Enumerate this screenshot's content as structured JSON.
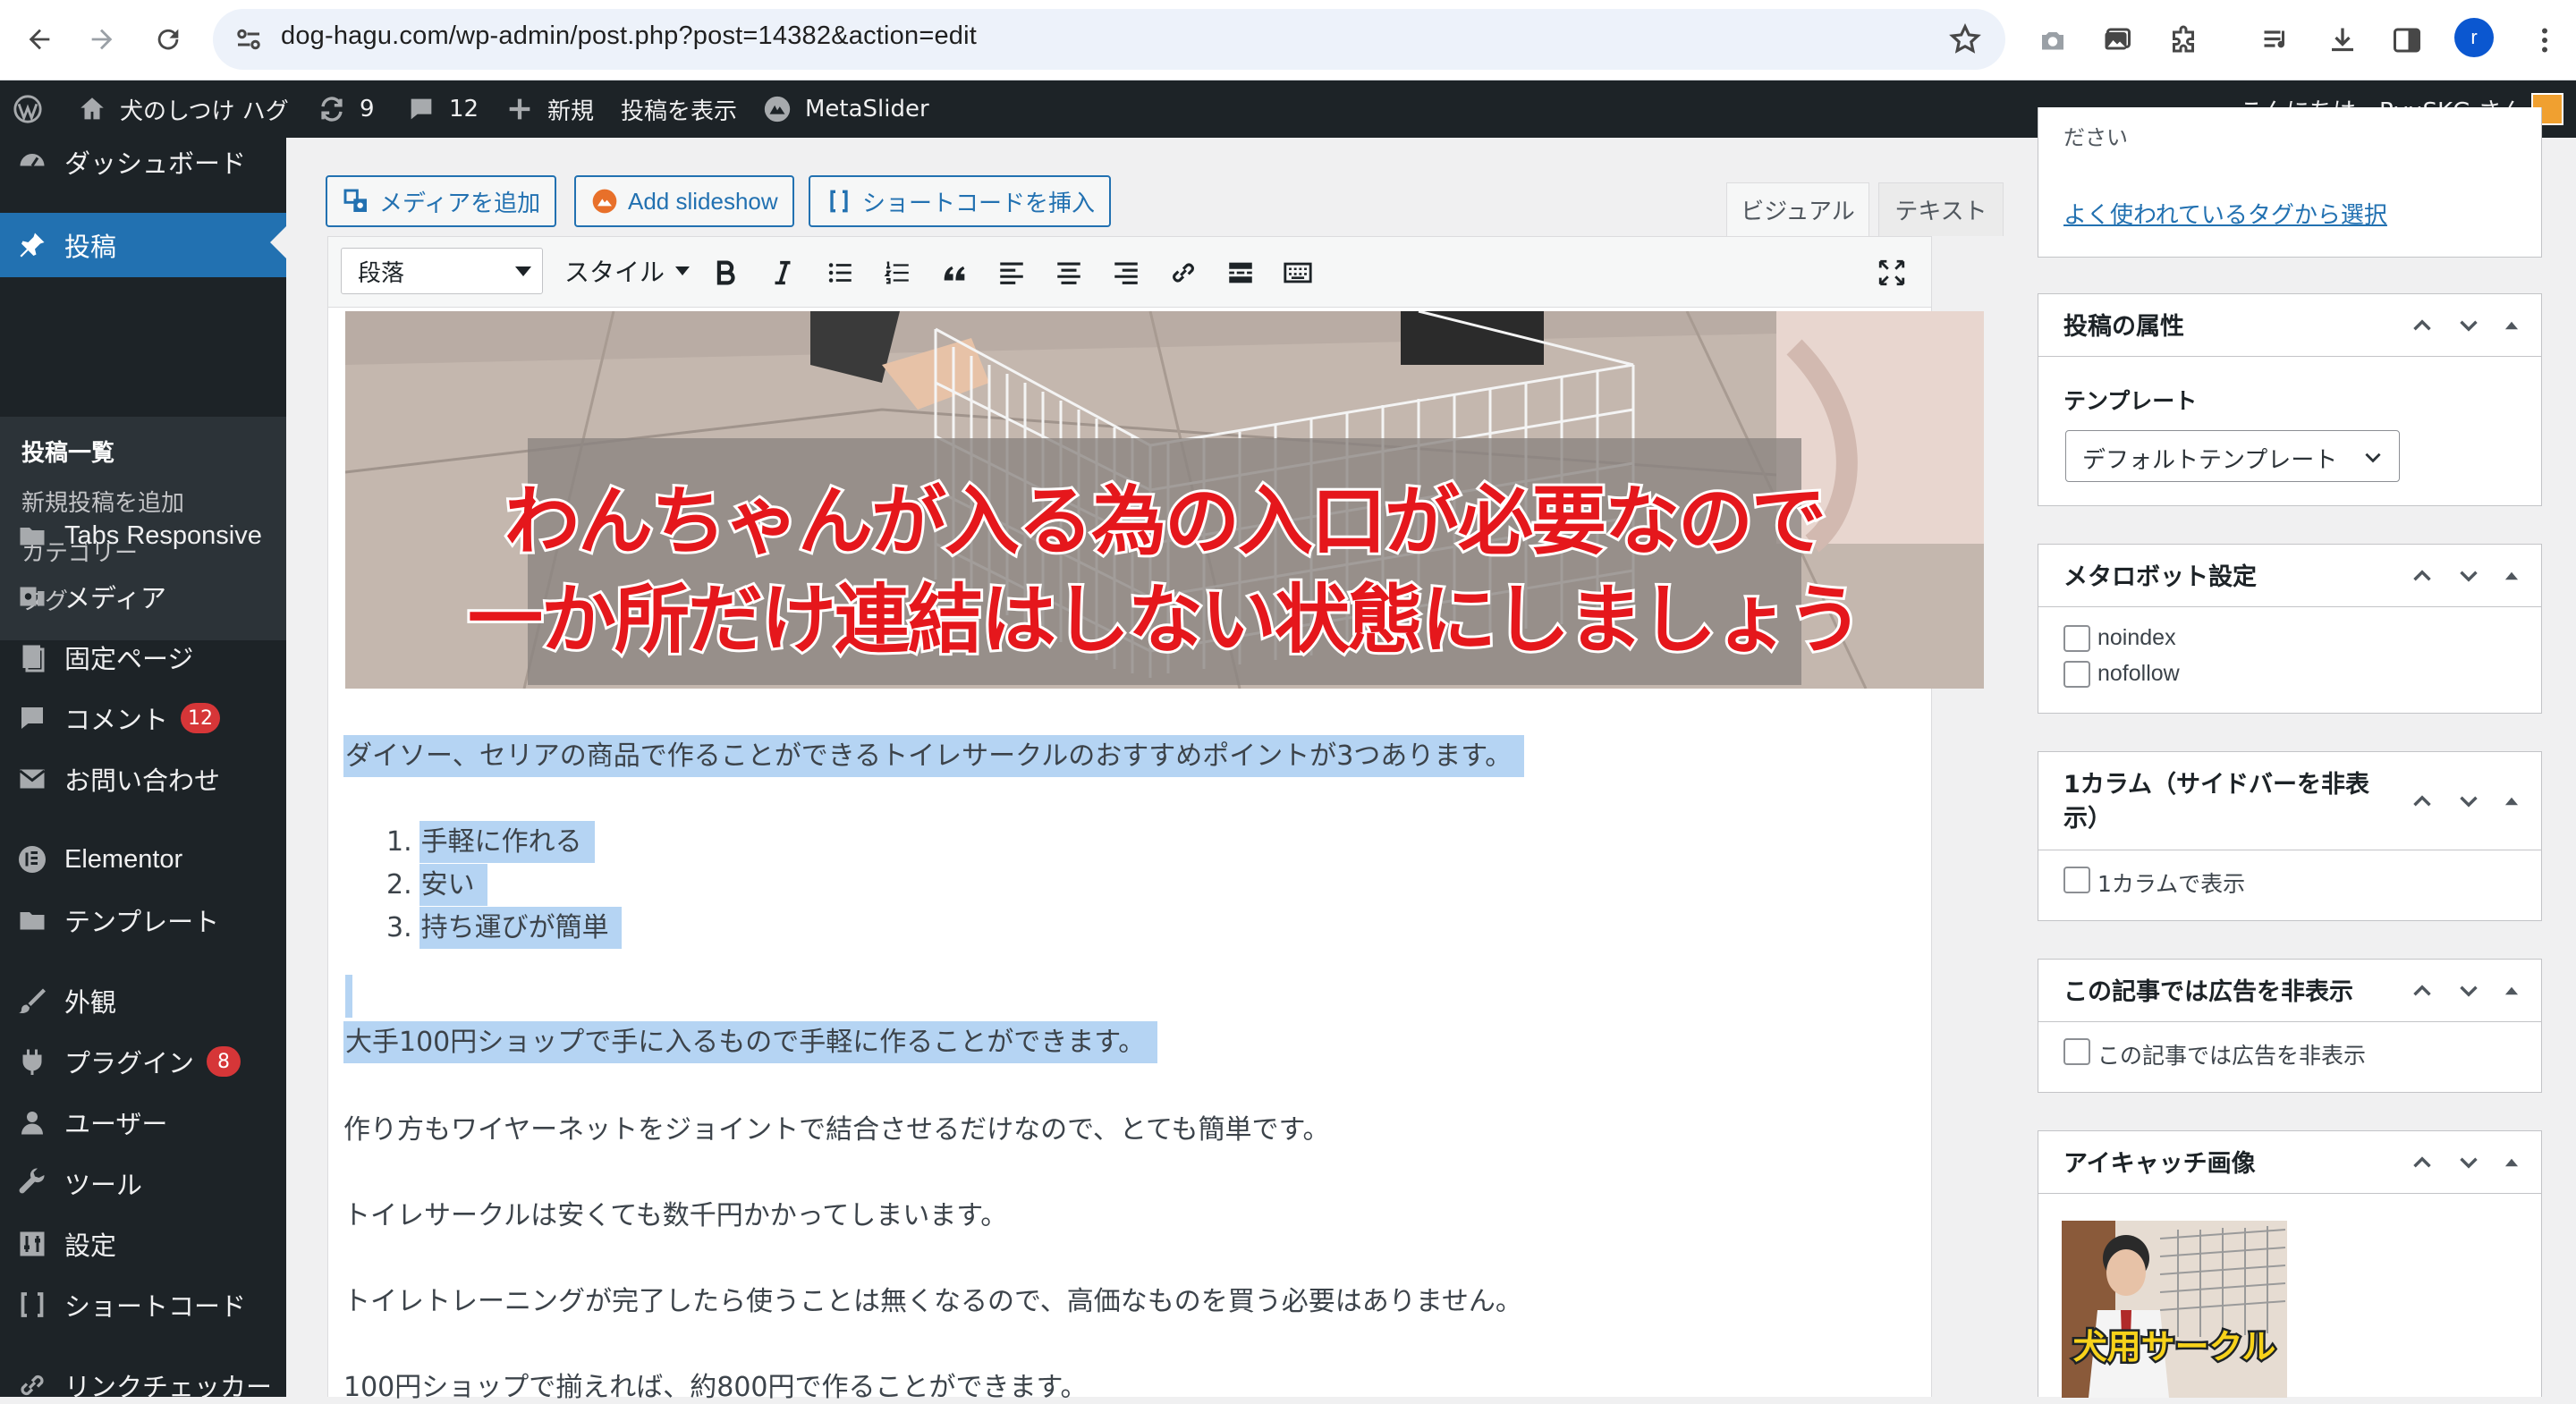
{
  "browser": {
    "url": "dog-hagu.com/wp-admin/post.php?post=14382&action=edit",
    "profile_initial": "r"
  },
  "adminbar": {
    "site_name": "犬のしつけ ハグ",
    "updates_count": "9",
    "comments_count": "12",
    "new_label": "新規",
    "view_post_label": "投稿を表示",
    "metaslider_label": "MetaSlider",
    "greeting": "こんにちは、RyuSKG さん"
  },
  "sidebar": {
    "dashboard": "ダッシュボード",
    "posts": "投稿",
    "posts_submenu": [
      "投稿一覧",
      "新規投稿を追加",
      "カテゴリー",
      "タグ"
    ],
    "tabs_responsive": "Tabs Responsive",
    "media": "メディア",
    "pages": "固定ページ",
    "comments": "コメント",
    "comments_badge": "12",
    "contact": "お問い合わせ",
    "elementor": "Elementor",
    "templates": "テンプレート",
    "appearance": "外観",
    "plugins": "プラグイン",
    "plugins_badge": "8",
    "users": "ユーザー",
    "tools": "ツール",
    "settings": "設定",
    "shortcode": "ショートコード",
    "link_checker": "リンクチェッカー"
  },
  "editor": {
    "add_media": "メディアを追加",
    "add_slideshow": "Add slideshow",
    "insert_shortcode": "ショートコードを挿入",
    "tab_visual": "ビジュアル",
    "tab_text": "テキスト",
    "format_select": "段落",
    "style_select": "スタイル",
    "image_caption_line1": "わんちゃんが入る為の入口が必要なので",
    "image_caption_line2": "一か所だけ連結はしない状態にしましょう",
    "paragraph1": "ダイソー、セリアの商品で作ることができるトイレサークルのおすすめポイントが3つあります。",
    "list": [
      "手軽に作れる",
      "安い",
      "持ち運びが簡単"
    ],
    "paragraph2": "大手100円ショップで手に入るもので手軽に作ることができます。",
    "paragraph3": "作り方もワイヤーネットをジョイントで結合させるだけなので、とても簡単です。",
    "paragraph4": "トイレサークルは安くても数千円かかってしまいます。",
    "paragraph5": "トイレトレーニングが完了したら使うことは無くなるので、高価なものを買う必要はありません。",
    "paragraph6": "100円ショップで揃えれば、約800円で作ることができます。"
  },
  "right_sidebar": {
    "tags_cutoff_text": "ださい",
    "tags_link": "よく使われているタグから選択",
    "attributes_title": "投稿の属性",
    "template_label": "テンプレート",
    "template_value": "デフォルトテンプレート",
    "metarobot_title": "メタロボット設定",
    "noindex": "noindex",
    "nofollow": "nofollow",
    "one_column_title": "1カラム（サイドバーを非表示）",
    "one_column_title_line1": "1カラム（サイドバーを非表",
    "one_column_title_line2": "示）",
    "one_column_check": "1カラムで表示",
    "hide_ads_title": "この記事では広告を非表示",
    "hide_ads_check": "この記事では広告を非表示",
    "featured_title": "アイキャッチ画像",
    "featured_caption": "犬用サークル"
  },
  "colors": {
    "admin_dark": "#1d2327",
    "accent_blue": "#2271b1",
    "badge_red": "#d63638",
    "selection": "#b5d4f3"
  }
}
